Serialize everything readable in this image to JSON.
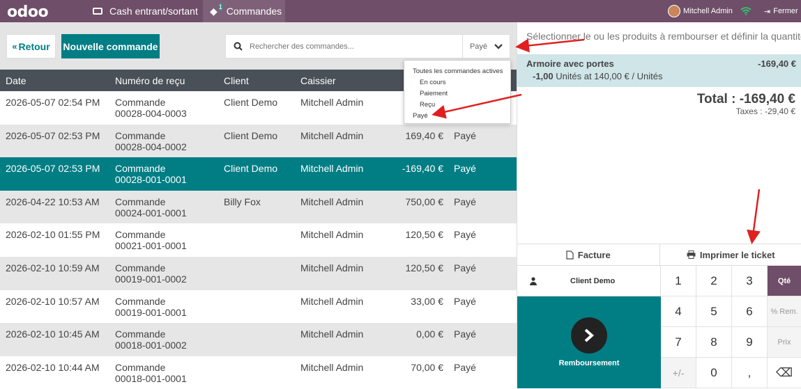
{
  "topbar": {
    "logo": "odoo",
    "nav": [
      {
        "label": "Cash entrant/sortant",
        "icon": "money-icon"
      },
      {
        "label": "Commandes",
        "icon": "ticket-icon",
        "badge": "1"
      }
    ],
    "user": "Mitchell Admin",
    "close_label": "Fermer"
  },
  "controls": {
    "back_label": "Retour",
    "new_order_label": "Nouvelle commande",
    "search_placeholder": "Rechercher des commandes...",
    "filter_value": "Payé"
  },
  "filter_menu": {
    "options": [
      "Toutes les commandes actives",
      "En cours",
      "Paiement",
      "Reçu",
      "Payé"
    ]
  },
  "table": {
    "headers": [
      "Date",
      "Numéro de reçu",
      "Client",
      "Caissier",
      "",
      ""
    ],
    "rows": [
      {
        "date": "2026-05-07 02:54 PM",
        "receipt1": "Commande",
        "receipt2": "00028-004-0003",
        "client": "Client Demo",
        "cashier": "Mitchell Admin",
        "total": "",
        "status": ""
      },
      {
        "date": "2026-05-07 02:53 PM",
        "receipt1": "Commande",
        "receipt2": "00028-004-0002",
        "client": "Client Demo",
        "cashier": "Mitchell Admin",
        "total": "169,40 €",
        "status": "Payé"
      },
      {
        "date": "2026-05-07 02:53 PM",
        "receipt1": "Commande",
        "receipt2": "00028-001-0001",
        "client": "Client Demo",
        "cashier": "Mitchell Admin",
        "total": "-169,40 €",
        "status": "Payé"
      },
      {
        "date": "2026-04-22 10:53 AM",
        "receipt1": "Commande",
        "receipt2": "00024-001-0001",
        "client": "Billy Fox",
        "cashier": "Mitchell Admin",
        "total": "750,00 €",
        "status": "Payé"
      },
      {
        "date": "2026-02-10 01:55 PM",
        "receipt1": "Commande",
        "receipt2": "00021-001-0001",
        "client": "",
        "cashier": "Mitchell Admin",
        "total": "120,50 €",
        "status": "Payé"
      },
      {
        "date": "2026-02-10 10:59 AM",
        "receipt1": "Commande",
        "receipt2": "00019-001-0002",
        "client": "",
        "cashier": "Mitchell Admin",
        "total": "120,50 €",
        "status": "Payé"
      },
      {
        "date": "2026-02-10 10:57 AM",
        "receipt1": "Commande",
        "receipt2": "00019-001-0001",
        "client": "",
        "cashier": "Mitchell Admin",
        "total": "33,00 €",
        "status": "Payé"
      },
      {
        "date": "2026-02-10 10:45 AM",
        "receipt1": "Commande",
        "receipt2": "00018-001-0002",
        "client": "",
        "cashier": "Mitchell Admin",
        "total": "0,00 €",
        "status": "Payé"
      },
      {
        "date": "2026-02-10 10:44 AM",
        "receipt1": "Commande",
        "receipt2": "00018-001-0001",
        "client": "",
        "cashier": "Mitchell Admin",
        "total": "70,00 €",
        "status": "Payé"
      }
    ]
  },
  "order": {
    "hint": "Sélectionner le ou les produits à rembourser et définir la quantité",
    "line_name": "Armoire avec portes",
    "line_price": "-169,40 €",
    "line_qty": "-1,00",
    "line_unit": " Unités at 140,00 € / Unités",
    "total": "Total : -169,40 €",
    "taxes": "Taxes : -29,40 €"
  },
  "actions": {
    "invoice_label": "Facture",
    "print_label": "Imprimer le ticket"
  },
  "pad": {
    "client_label": "Client Demo",
    "refund_label": "Remboursement",
    "keys": [
      "1",
      "2",
      "3",
      "Qté",
      "4",
      "5",
      "6",
      "% Rem.",
      "7",
      "8",
      "9",
      "Prix",
      "+/-",
      "0",
      ",",
      "⌫"
    ]
  },
  "colors": {
    "brand": "#6e4e68",
    "teal": "#017e84",
    "header_dark": "#495057",
    "annotation_arrow": "#e02020"
  }
}
